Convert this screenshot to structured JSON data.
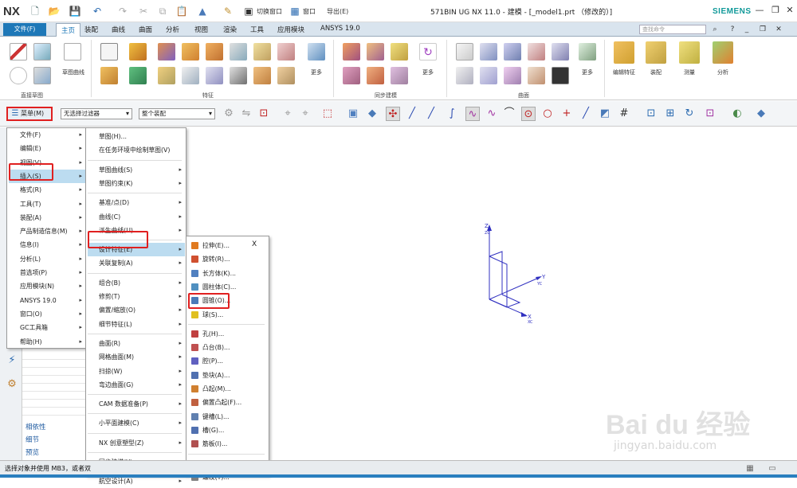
{
  "titlebar": {
    "logo": "NX",
    "window_title": "571BIN UG NX 11.0 - 建模 - [_model1.prt （修改的）]",
    "brand": "SIEMENS",
    "switch_window": "切换窗口",
    "window_menu": "窗口",
    "export_menu": "导出(E)"
  },
  "ribbon_tabs": {
    "file": "文件(F)",
    "tabs": [
      "主页",
      "装配",
      "曲线",
      "曲面",
      "分析",
      "视图",
      "渲染",
      "工具",
      "应用模块",
      "ANSYS 19.0"
    ],
    "active": "主页",
    "search_placeholder": "查找命令"
  },
  "ribbon_groups": {
    "direct_sketch": "直接草图",
    "sketch_curve": "草图曲线",
    "feature": "特征",
    "sync_model": "同步建模",
    "surface": "曲面",
    "more": "更多",
    "edit_feature": "编辑特征",
    "assembly": "装配",
    "measure": "测量",
    "analysis": "分析"
  },
  "toolbar": {
    "menu_button": "菜单(M)",
    "filter_combo": "无选择过滤器",
    "assembly_combo": "整个装配"
  },
  "menu1": [
    {
      "label": "文件(F)",
      "sub": true
    },
    {
      "label": "编辑(E)",
      "sub": true
    },
    {
      "label": "视图(V)",
      "sub": true
    },
    {
      "label": "插入(S)",
      "sub": true
    },
    {
      "label": "格式(R)",
      "sub": true
    },
    {
      "label": "工具(T)",
      "sub": true
    },
    {
      "label": "装配(A)",
      "sub": true
    },
    {
      "label": "产品制造信息(M)",
      "sub": true
    },
    {
      "label": "信息(I)",
      "sub": true
    },
    {
      "label": "分析(L)",
      "sub": true
    },
    {
      "label": "首选项(P)",
      "sub": true
    },
    {
      "label": "应用模块(N)",
      "sub": true
    },
    {
      "label": "ANSYS 19.0",
      "sub": true
    },
    {
      "label": "窗口(O)",
      "sub": true
    },
    {
      "label": "GC工具箱",
      "sub": true
    },
    {
      "label": "帮助(H)",
      "sub": true
    }
  ],
  "menu2": [
    {
      "label": "草图(H)...",
      "sub": false
    },
    {
      "label": "在任务环境中绘制草图(V)",
      "sub": false
    },
    {
      "label": "草图曲线(S)",
      "sub": true
    },
    {
      "label": "草图约束(K)",
      "sub": true
    },
    {
      "label": "基准/点(D)",
      "sub": true
    },
    {
      "label": "曲线(C)",
      "sub": true
    },
    {
      "label": "派生曲线(U)",
      "sub": true
    },
    {
      "label": "设计特征(E)",
      "sub": true
    },
    {
      "label": "关联复制(A)",
      "sub": true
    },
    {
      "label": "组合(B)",
      "sub": true
    },
    {
      "label": "修剪(T)",
      "sub": true
    },
    {
      "label": "偏置/缩放(O)",
      "sub": true
    },
    {
      "label": "细节特征(L)",
      "sub": true
    },
    {
      "label": "曲面(R)",
      "sub": true
    },
    {
      "label": "网格曲面(M)",
      "sub": true
    },
    {
      "label": "扫掠(W)",
      "sub": true
    },
    {
      "label": "弯边曲面(G)",
      "sub": true
    },
    {
      "label": "CAM 数据准备(P)",
      "sub": true
    },
    {
      "label": "小平面建模(C)",
      "sub": true
    },
    {
      "label": "NX 创意塑型(Z)",
      "sub": true
    },
    {
      "label": "同步建模(Y)",
      "sub": true
    },
    {
      "label": "航空设计(A)",
      "sub": true
    }
  ],
  "menu3": [
    {
      "label": "拉伸(E)...",
      "icon": "#e07a20"
    },
    {
      "label": "旋转(R)...",
      "icon": "#d05030"
    },
    {
      "label": "长方体(K)...",
      "icon": "#5080c0"
    },
    {
      "label": "圆柱体(C)...",
      "icon": "#5090c0"
    },
    {
      "label": "圆锥(O)...",
      "icon": "#4a7ab8"
    },
    {
      "label": "球(S)...",
      "icon": "#e0c020"
    },
    {
      "label": "孔(H)...",
      "icon": "#c04040"
    },
    {
      "label": "凸台(B)...",
      "icon": "#c05050"
    },
    {
      "label": "腔(P)...",
      "icon": "#6060c0"
    },
    {
      "label": "垫块(A)...",
      "icon": "#5070b0"
    },
    {
      "label": "凸起(M)...",
      "icon": "#d08030"
    },
    {
      "label": "偏置凸起(F)...",
      "icon": "#c06040"
    },
    {
      "label": "键槽(L)...",
      "icon": "#6080b0"
    },
    {
      "label": "槽(G)...",
      "icon": "#5070b0"
    },
    {
      "label": "筋板(I)...",
      "icon": "#b05050"
    },
    {
      "label": "三角形加强筋(D)...",
      "icon": "#7070b0"
    },
    {
      "label": "螺纹(T)...",
      "icon": "#808080"
    }
  ],
  "menu3_close": "X",
  "nav_panel": {
    "dependencies": "相依性",
    "details": "细节",
    "preview": "预览"
  },
  "status": "选择对象并使用 MB3，或者双",
  "axes": {
    "x": "X",
    "y": "Y",
    "z": "Z",
    "xc": "XC",
    "yc": "YC",
    "zc": "ZC"
  },
  "watermark": {
    "line1": "Bai du 经验",
    "line2": "jingyan.baidu.com"
  }
}
